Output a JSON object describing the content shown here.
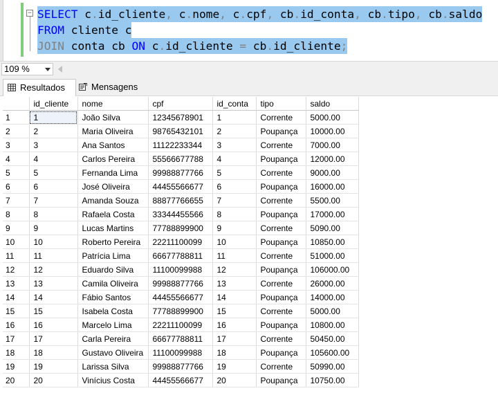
{
  "editor": {
    "collapse_symbol": "−",
    "line1": {
      "kw1": "SELECT",
      "t1": " c",
      "g1": ".",
      "t2": "id_cliente",
      "g2": ",",
      "t3": " c",
      "g3": ".",
      "t4": "nome",
      "g4": ",",
      "t5": " c",
      "g5": ".",
      "t6": "cpf",
      "g6": ",",
      "t7": " cb",
      "g7": ".",
      "t8": "id_conta",
      "g8": ",",
      "t9": " cb",
      "g9": ".",
      "t10": "tipo",
      "g10": ",",
      "t11": " cb",
      "g11": ".",
      "t12": "saldo"
    },
    "line2": {
      "kw1": "FROM",
      "t1": " cliente c"
    },
    "line3": {
      "kw1": "JOIN",
      "t1": " conta cb ",
      "kw2": "ON",
      "t2": " c",
      "g1": ".",
      "t3": "id_cliente",
      "g2": " = ",
      "t4": "cb",
      "g3": ".",
      "t5": "id_cliente",
      "g4": ";"
    }
  },
  "zoom": {
    "value": "109 %"
  },
  "tabs": {
    "results": "Resultados",
    "messages": "Mensagens"
  },
  "grid": {
    "columns": [
      "id_cliente",
      "nome",
      "cpf",
      "id_conta",
      "tipo",
      "saldo"
    ],
    "rows": [
      {
        "n": "1",
        "id": "1",
        "nome": "João Silva",
        "cpf": "12345678901",
        "conta": "1",
        "tipo": "Corrente",
        "saldo": "5000.00"
      },
      {
        "n": "2",
        "id": "2",
        "nome": "Maria Oliveira",
        "cpf": "98765432101",
        "conta": "2",
        "tipo": "Poupança",
        "saldo": "10000.00"
      },
      {
        "n": "3",
        "id": "3",
        "nome": "Ana Santos",
        "cpf": "11122233344",
        "conta": "3",
        "tipo": "Corrente",
        "saldo": "7000.00"
      },
      {
        "n": "4",
        "id": "4",
        "nome": "Carlos Pereira",
        "cpf": "55566677788",
        "conta": "4",
        "tipo": "Poupança",
        "saldo": "12000.00"
      },
      {
        "n": "5",
        "id": "5",
        "nome": "Fernanda Lima",
        "cpf": "99988877766",
        "conta": "5",
        "tipo": "Corrente",
        "saldo": "9000.00"
      },
      {
        "n": "6",
        "id": "6",
        "nome": "José Oliveira",
        "cpf": "44455566677",
        "conta": "6",
        "tipo": "Poupança",
        "saldo": "16000.00"
      },
      {
        "n": "7",
        "id": "7",
        "nome": "Amanda Souza",
        "cpf": "88877766655",
        "conta": "7",
        "tipo": "Corrente",
        "saldo": "5500.00"
      },
      {
        "n": "8",
        "id": "8",
        "nome": "Rafaela Costa",
        "cpf": "33344455566",
        "conta": "8",
        "tipo": "Poupança",
        "saldo": "17000.00"
      },
      {
        "n": "9",
        "id": "9",
        "nome": "Lucas Martins",
        "cpf": "77788899900",
        "conta": "9",
        "tipo": "Corrente",
        "saldo": "5090.00"
      },
      {
        "n": "10",
        "id": "10",
        "nome": "Roberto Pereira",
        "cpf": "22211100099",
        "conta": "10",
        "tipo": "Poupança",
        "saldo": "10850.00"
      },
      {
        "n": "11",
        "id": "11",
        "nome": "Patrícia Lima",
        "cpf": "66677788811",
        "conta": "11",
        "tipo": "Corrente",
        "saldo": "51000.00"
      },
      {
        "n": "12",
        "id": "12",
        "nome": "Eduardo Silva",
        "cpf": "11100099988",
        "conta": "12",
        "tipo": "Poupança",
        "saldo": "106000.00"
      },
      {
        "n": "13",
        "id": "13",
        "nome": "Camila Oliveira",
        "cpf": "99988877766",
        "conta": "13",
        "tipo": "Corrente",
        "saldo": "26000.00"
      },
      {
        "n": "14",
        "id": "14",
        "nome": "Fábio Santos",
        "cpf": "44455566677",
        "conta": "14",
        "tipo": "Poupança",
        "saldo": "14000.00"
      },
      {
        "n": "15",
        "id": "15",
        "nome": "Isabela Costa",
        "cpf": "77788899900",
        "conta": "15",
        "tipo": "Corrente",
        "saldo": "5000.00"
      },
      {
        "n": "16",
        "id": "16",
        "nome": "Marcelo Lima",
        "cpf": "22211100099",
        "conta": "16",
        "tipo": "Poupança",
        "saldo": "10800.00"
      },
      {
        "n": "17",
        "id": "17",
        "nome": "Carla Pereira",
        "cpf": "66677788811",
        "conta": "17",
        "tipo": "Corrente",
        "saldo": "50450.00"
      },
      {
        "n": "18",
        "id": "18",
        "nome": "Gustavo Oliveira",
        "cpf": "11100099988",
        "conta": "18",
        "tipo": "Poupança",
        "saldo": "105600.00"
      },
      {
        "n": "19",
        "id": "19",
        "nome": "Larissa Silva",
        "cpf": "99988877766",
        "conta": "19",
        "tipo": "Corrente",
        "saldo": "50990.00"
      },
      {
        "n": "20",
        "id": "20",
        "nome": "Vinícius Costa",
        "cpf": "44455566677",
        "conta": "20",
        "tipo": "Poupança",
        "saldo": "10750.00"
      }
    ]
  }
}
